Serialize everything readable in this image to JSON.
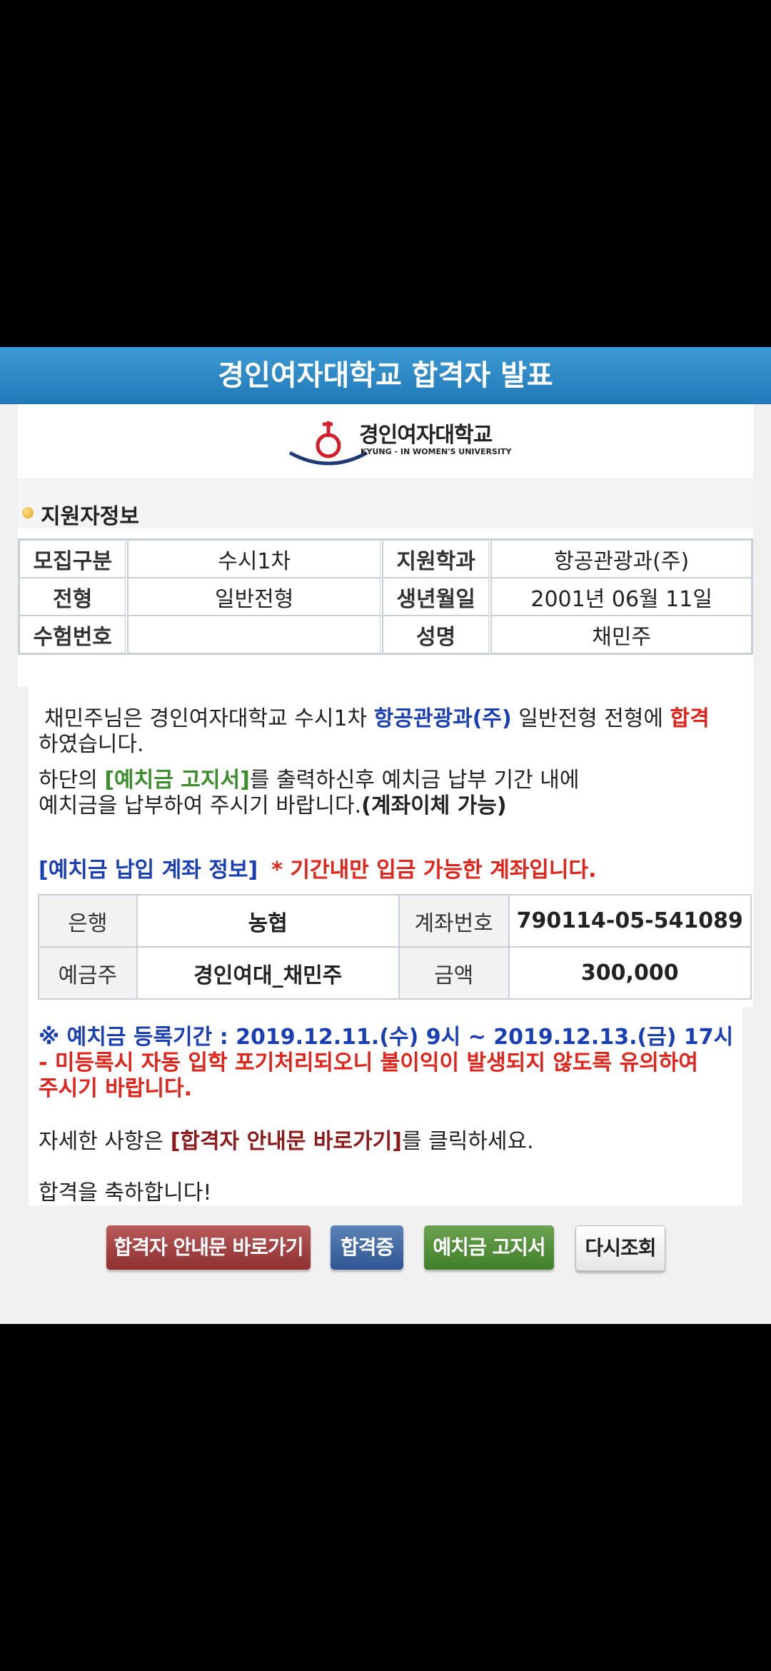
{
  "header": {
    "title": "경인여자대학교 합격자 발표"
  },
  "logo": {
    "name_ko": "경인여자대학교",
    "name_en": "KYUNG - IN WOMEN'S UNIVERSITY"
  },
  "applicant_section": {
    "title": "지원자정보",
    "rows": [
      {
        "label1": "모집구분",
        "value1": "수시1차",
        "label2": "지원학과",
        "value2": "항공관광과(주)"
      },
      {
        "label1": "전형",
        "value1": "일반전형",
        "label2": "생년월일",
        "value2": "2001년 06월 11일"
      },
      {
        "label1": "수험번호",
        "value1": "",
        "label2": "성명",
        "value2": "채민주"
      }
    ]
  },
  "notice": {
    "line1_a": "채민주님은 경인여자대학교 수시1차 ",
    "line1_dept": "항공관광과(주)",
    "line1_b": " 일반전형 전형에 ",
    "line1_result": "합격",
    "line2": "하였습니다.",
    "line3_a": "하단의 ",
    "line3_link": "[예치금 고지서]",
    "line3_b": "를 출력하신후 예치금 납부 기간 내에",
    "line4_a": "예치금을 납부하여 주시기 바랍니다.",
    "line4_b": "(계좌이체 가능)",
    "account_title": "[예치금 납입 계좌 정보]",
    "account_note": "* 기간내만 입금 가능한 계좌입니다.",
    "account": [
      {
        "label1": "은행",
        "value1": "농협",
        "label2": "계좌번호",
        "value2": "790114-05-541089"
      },
      {
        "label1": "예금주",
        "value1": "경인여대_채민주",
        "label2": "금액",
        "value2": "300,000"
      }
    ],
    "period": "※ 예치금 등록기간 : 2019.12.11.(수) 9시 ~ 2019.12.13.(금) 17시",
    "warning_1": " -  미등록시 자동 입학 포기처리되오니 불이익이 발생되지 않도록 유의하여",
    "warning_2": "주시기 바랍니다.",
    "detail_a": "자세한 사항은 ",
    "detail_link": "[합격자 안내문 바로가기]",
    "detail_b": "를 클릭하세요.",
    "congrats": "합격을 축하합니다!"
  },
  "buttons": {
    "guide": "합격자 안내문 바로가기",
    "certificate": "합격증",
    "deposit_notice": "예치금 고지서",
    "retry": "다시조회"
  },
  "colors": {
    "banner": "#2a86c6",
    "accent_blue": "#1a3fb5",
    "accent_red": "#e2231a",
    "accent_green": "#3b8c2b",
    "accent_maroon": "#8c1a1a"
  }
}
